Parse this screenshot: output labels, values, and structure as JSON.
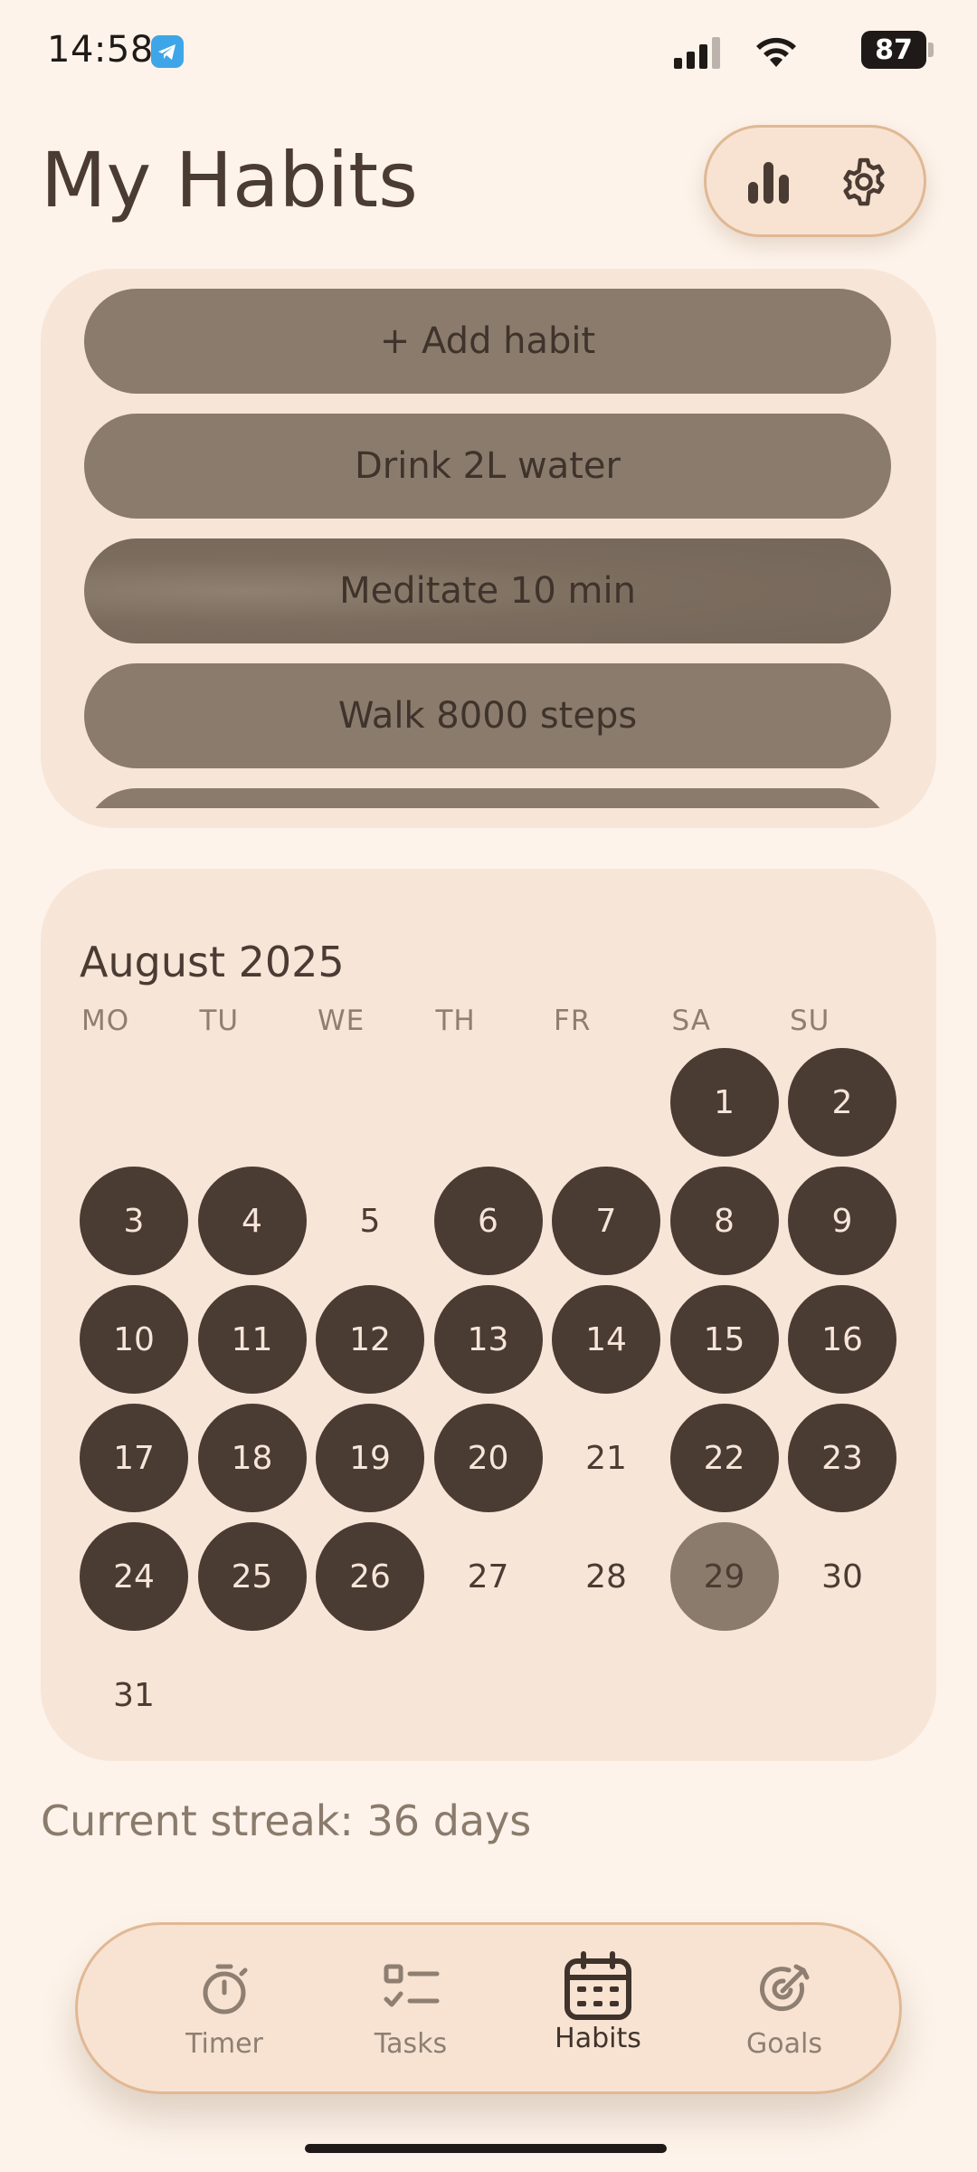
{
  "status_bar": {
    "time": "14:58",
    "battery": "87",
    "icons": [
      "telegram-icon",
      "signal-icon",
      "wifi-icon",
      "battery-icon"
    ]
  },
  "header": {
    "title": "My Habits",
    "actions": [
      "stats-chart-icon",
      "settings-gear-icon"
    ]
  },
  "habits": {
    "add_label": "+ Add habit",
    "items": [
      "Drink 2L water",
      "Meditate 10 min",
      "Walk 8000 steps",
      ""
    ]
  },
  "calendar": {
    "month_label": "August 2025",
    "weekdays": [
      "MO",
      "TU",
      "WE",
      "TH",
      "FR",
      "SA",
      "SU"
    ],
    "first_weekday_index": 5,
    "days_in_month": 31,
    "completed_days": [
      1,
      2,
      3,
      4,
      6,
      7,
      8,
      9,
      10,
      11,
      12,
      13,
      14,
      15,
      16,
      17,
      18,
      19,
      20,
      22,
      23,
      24,
      25,
      26
    ],
    "today": 29
  },
  "streak": {
    "text": "Current streak: 36 days"
  },
  "nav": {
    "items": [
      {
        "label": "Timer",
        "icon": "stopwatch-icon"
      },
      {
        "label": "Tasks",
        "icon": "checklist-icon"
      },
      {
        "label": "Habits",
        "icon": "calendar-icon",
        "active": true
      },
      {
        "label": "Goals",
        "icon": "target-arrow-icon"
      }
    ]
  },
  "colors": {
    "background": "#fdf3ea",
    "card": "#f7e5d8",
    "done_day": "#4a3b33",
    "today_day": "#8a7b6c",
    "habit_pill": "#8a7b6c",
    "accent_border": "#e0b894"
  }
}
